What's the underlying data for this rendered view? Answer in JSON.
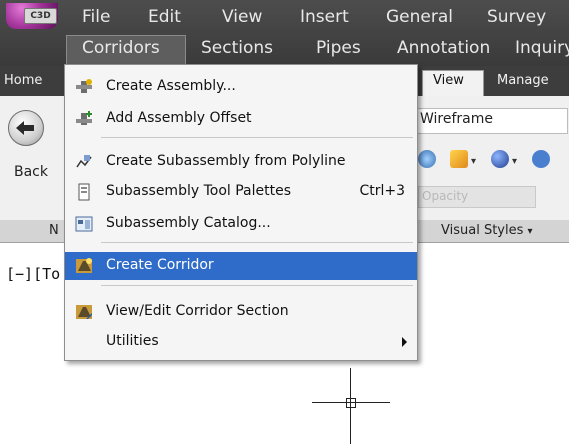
{
  "app": {
    "logo_text": "C3D"
  },
  "menubar": {
    "row1": [
      "File",
      "Edit",
      "View",
      "Insert",
      "General",
      "Survey"
    ],
    "row2": [
      "Corridors",
      "Sections",
      "Pipes",
      "Annotation",
      "Inquiry"
    ]
  },
  "ribbon": {
    "tabs": [
      "Home",
      "View",
      "Manage"
    ],
    "back_label": "Back",
    "wireframe_label": "Wireframe",
    "opacity_label": "Opacity",
    "visual_styles_label": "Visual Styles",
    "panel_label_partial": "N"
  },
  "viewport": {
    "label": "[−][To"
  },
  "dropdown": {
    "items": [
      {
        "label": "Create Assembly...",
        "icon": "create-assembly-icon"
      },
      {
        "label": "Add Assembly Offset",
        "icon": "add-assembly-offset-icon"
      },
      {
        "label": "Create Subassembly from Polyline",
        "icon": "create-subassembly-polyline-icon"
      },
      {
        "label": "Subassembly Tool Palettes",
        "shortcut": "Ctrl+3",
        "icon": "tool-palettes-icon"
      },
      {
        "label": "Subassembly Catalog...",
        "icon": "subassembly-catalog-icon"
      },
      {
        "label": "Create Corridor",
        "icon": "create-corridor-icon",
        "highlighted": true
      },
      {
        "label": "View/Edit Corridor Section",
        "icon": "view-edit-corridor-section-icon"
      },
      {
        "label": "Utilities",
        "submenu": true
      }
    ]
  },
  "colors": {
    "menubar_bg": "#3f3f3f",
    "highlight": "#2f6cc9",
    "menu_text": "#e8e8e8"
  }
}
